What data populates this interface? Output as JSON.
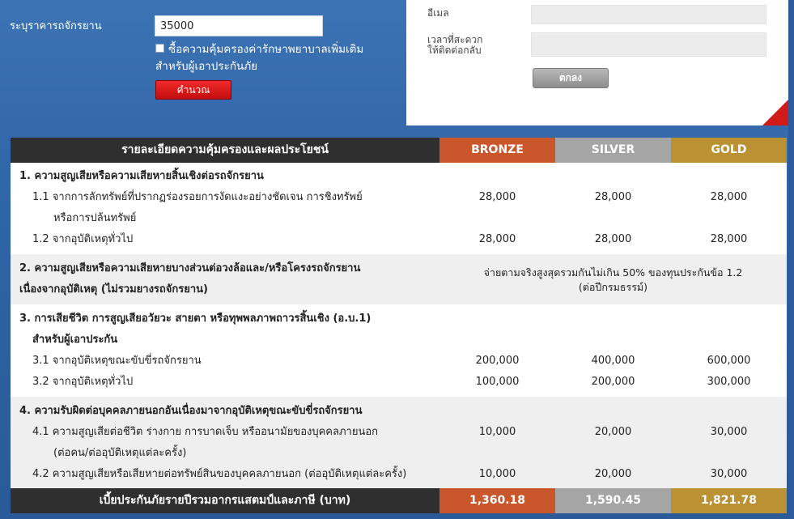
{
  "calc": {
    "sum_label": "ระบุราคารถจักรยาน",
    "sum_value": "35000",
    "checkbox_text_1": "ซื้อความคุ้มครองค่ารักษาพยาบาลเพิ่มเติม",
    "checkbox_text_2": "สำหรับผู้เอาประกันภัย",
    "button": "คำนวณ"
  },
  "contact": {
    "email_label": "อีเมล",
    "time_label_1": "เวลาที่สะดวก",
    "time_label_2": "ให้ติดต่อกลับ",
    "button": "ตกลง"
  },
  "table": {
    "header": "รายละเอียดความคุ้มครองและผลประโยชน์",
    "plans": [
      "BRONZE",
      "SILVER",
      "GOLD"
    ],
    "s1": {
      "title": "1. ความสูญเสียหรือความเสียหายสิ้นเชิงต่อรถจักรยาน",
      "r1_label_1": "1.1 จากการลักทรัพย์ที่ปรากฏร่องรอยการงัดแงะอย่างชัดเจน การชิงทรัพย์",
      "r1_label_2": "หรือการปล้นทรัพย์",
      "r1": [
        "28,000",
        "28,000",
        "28,000"
      ],
      "r2_label": "1.2 จากอุบัติเหตุทั่วไป",
      "r2": [
        "28,000",
        "28,000",
        "28,000"
      ]
    },
    "s2": {
      "title_1": "2. ความสูญเสียหรือความเสียหายบางส่วนต่อวงล้อและ/หรือโครงรถจักรยาน",
      "title_2": "เนื่องจากอุบัติเหตุ (ไม่รวมยางรถจักรยาน)",
      "note_1": "จ่ายตามจริงสูงสุดรวมกันไม่เกิน 50% ของทุนประกันข้อ 1.2",
      "note_2": "(ต่อปีกรมธรรม์)"
    },
    "s3": {
      "title_1": "3. การเสียชีวิต การสูญเสียอวัยวะ สายตา หรือทุพพลภาพถาวรสิ้นเชิง (อ.บ.1)",
      "title_2": "สำหรับผู้เอาประกัน",
      "r1_label": "3.1 จากอุบัติเหตุขณะขับขี่รถจักรยาน",
      "r1": [
        "200,000",
        "400,000",
        "600,000"
      ],
      "r2_label": "3.2 จากอุบัติเหตุทั่วไป",
      "r2": [
        "100,000",
        "200,000",
        "300,000"
      ]
    },
    "s4": {
      "title": "4. ความรับผิดต่อบุคคลภายนอกอันเนื่องมาจากอุบัติเหตุขณะขับขี่รถจักรยาน",
      "r1_label_1": "4.1 ความสูญเสียต่อชีวิต ร่างกาย การบาดเจ็บ หรืออนามัยของบุคคลภายนอก",
      "r1_label_2": "(ต่อคน/ต่ออุบัติเหตุแต่ละครั้ง)",
      "r1": [
        "10,000",
        "20,000",
        "30,000"
      ],
      "r2_label": "4.2 ความสูญเสียหรือเสียหายต่อทรัพย์สินของบุคคลภายนอก (ต่ออุบัติเหตุแต่ละครั้ง)",
      "r2": [
        "10,000",
        "20,000",
        "30,000"
      ]
    },
    "total_label": "เบี้ยประกันภัยรายปีรวมอากรแสตมป์และภาษี (บาท)",
    "totals": [
      "1,360.18",
      "1,590.45",
      "1,821.78"
    ]
  }
}
